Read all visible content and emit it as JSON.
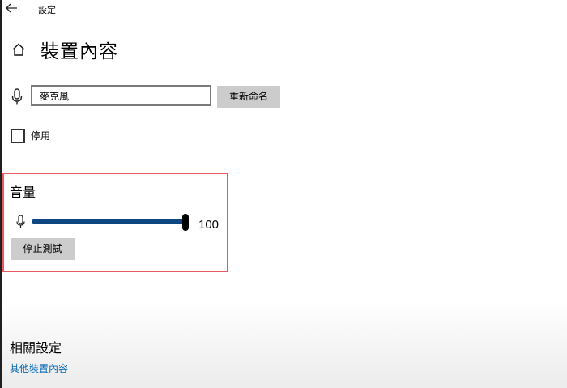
{
  "titlebar": {
    "title": "設定",
    "back_icon": "back-arrow-icon"
  },
  "header": {
    "title": "裝置內容",
    "home_icon": "home-icon"
  },
  "device": {
    "mic_icon": "microphone-icon",
    "name_value": "麥克風",
    "rename_label": "重新命名"
  },
  "disable": {
    "label": "停用",
    "checked": false
  },
  "volume": {
    "title": "音量",
    "mic_icon": "microphone-icon",
    "value": "100",
    "stop_test_label": "停止測試"
  },
  "related": {
    "title": "相關設定",
    "link_label": "其他裝置內容"
  },
  "colors": {
    "accent": "#0e4780",
    "link": "#0066b4",
    "highlight_border": "#e85a5f",
    "button_bg": "#cccccc"
  }
}
